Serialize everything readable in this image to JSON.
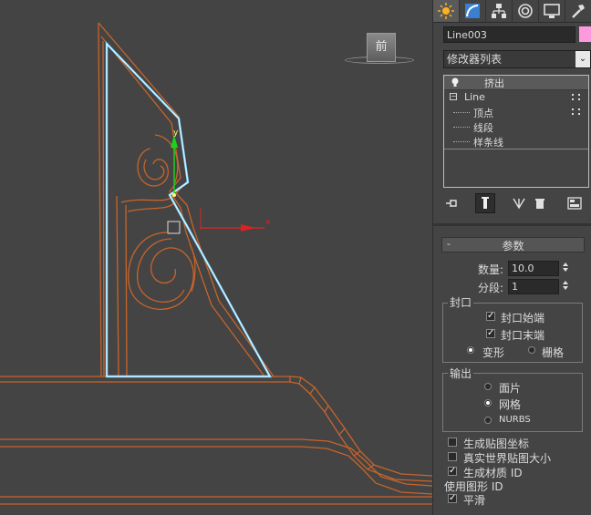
{
  "viewport": {
    "viewcube_label": "前",
    "gizmo_y_label": "y",
    "gizmo_x_label": "x"
  },
  "panel": {
    "tabs": [
      {
        "name": "create-tab",
        "icon": "sun-icon",
        "active": true
      },
      {
        "name": "modify-tab",
        "icon": "arc-icon",
        "active": false
      },
      {
        "name": "hierarchy-tab",
        "icon": "hierarchy-icon",
        "active": false
      },
      {
        "name": "motion-tab",
        "icon": "motion-icon",
        "active": false
      },
      {
        "name": "display-tab",
        "icon": "monitor-icon",
        "active": false
      },
      {
        "name": "utilities-tab",
        "icon": "hammer-icon",
        "active": false
      }
    ],
    "object_name": "Line003",
    "object_color": "#ff99dd",
    "modifier_list": "修改器列表",
    "stack": {
      "top_modifier": "挤出",
      "base_object": "Line",
      "subobjects": [
        "顶点",
        "线段",
        "样条线"
      ]
    }
  },
  "params": {
    "title": "参数",
    "collapse": "-",
    "amount_label": "数量:",
    "amount_value": "10.0",
    "segments_label": "分段:",
    "segments_value": "1",
    "capping_title": "封口",
    "cap_start_label": "封口始端",
    "cap_start_checked": true,
    "cap_end_label": "封口末端",
    "cap_end_checked": true,
    "morph_label": "变形",
    "grid_label": "栅格",
    "cap_type_selected": "变形",
    "output_title": "输出",
    "output_options": [
      "面片",
      "网格",
      "NURBS"
    ],
    "output_selected": "网格",
    "gen_mapping_label": "生成贴图坐标",
    "gen_mapping_checked": false,
    "real_world_label": "真实世界贴图大小",
    "real_world_checked": false,
    "gen_matid_label": "生成材质 ID",
    "gen_matid_checked": true,
    "use_shape_ids_label": "使用图形 ID",
    "smooth_label": "平滑",
    "smooth_checked": true
  }
}
